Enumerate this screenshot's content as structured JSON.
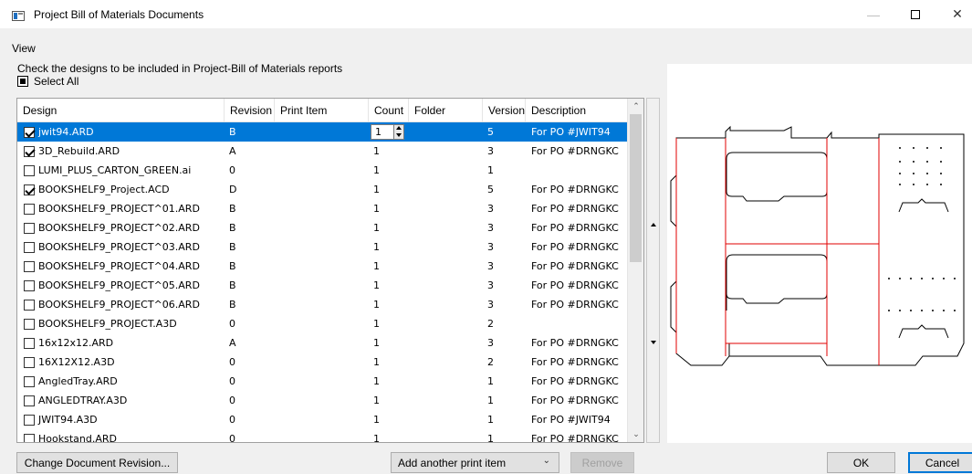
{
  "window": {
    "title": "Project Bill of Materials Documents"
  },
  "menu": {
    "view": "View"
  },
  "instructions": "Check the designs to be included in Project-Bill of Materials reports",
  "select_all": {
    "label": "Select All",
    "state": "indeterminate"
  },
  "columns": [
    "Design",
    "Revision",
    "Print Item",
    "Count",
    "Folder",
    "Version",
    "Description"
  ],
  "rows": [
    {
      "checked": true,
      "design": "jwit94.ARD",
      "revision": "B",
      "print_item": "",
      "count": "1",
      "folder": "",
      "version": "5",
      "description": "For PO #JWIT94",
      "selected": true
    },
    {
      "checked": true,
      "design": "3D_Rebuild.ARD",
      "revision": "A",
      "print_item": "",
      "count": "1",
      "folder": "",
      "version": "3",
      "description": "For PO #DRNGKC"
    },
    {
      "checked": false,
      "design": "LUMI_PLUS_CARTON_GREEN.ai",
      "revision": "0",
      "print_item": "",
      "count": "1",
      "folder": "",
      "version": "1",
      "description": ""
    },
    {
      "checked": true,
      "design": "BOOKSHELF9_Project.ACD",
      "revision": "D",
      "print_item": "",
      "count": "1",
      "folder": "",
      "version": "5",
      "description": "For PO #DRNGKC"
    },
    {
      "checked": false,
      "design": "BOOKSHELF9_PROJECT^01.ARD",
      "revision": "B",
      "print_item": "",
      "count": "1",
      "folder": "",
      "version": "3",
      "description": "For PO #DRNGKC"
    },
    {
      "checked": false,
      "design": "BOOKSHELF9_PROJECT^02.ARD",
      "revision": "B",
      "print_item": "",
      "count": "1",
      "folder": "",
      "version": "3",
      "description": "For PO #DRNGKC"
    },
    {
      "checked": false,
      "design": "BOOKSHELF9_PROJECT^03.ARD",
      "revision": "B",
      "print_item": "",
      "count": "1",
      "folder": "",
      "version": "3",
      "description": "For PO #DRNGKC"
    },
    {
      "checked": false,
      "design": "BOOKSHELF9_PROJECT^04.ARD",
      "revision": "B",
      "print_item": "",
      "count": "1",
      "folder": "",
      "version": "3",
      "description": "For PO #DRNGKC"
    },
    {
      "checked": false,
      "design": "BOOKSHELF9_PROJECT^05.ARD",
      "revision": "B",
      "print_item": "",
      "count": "1",
      "folder": "",
      "version": "3",
      "description": "For PO #DRNGKC"
    },
    {
      "checked": false,
      "design": "BOOKSHELF9_PROJECT^06.ARD",
      "revision": "B",
      "print_item": "",
      "count": "1",
      "folder": "",
      "version": "3",
      "description": "For PO #DRNGKC"
    },
    {
      "checked": false,
      "design": "BOOKSHELF9_PROJECT.A3D",
      "revision": "0",
      "print_item": "",
      "count": "1",
      "folder": "",
      "version": "2",
      "description": ""
    },
    {
      "checked": false,
      "design": "16x12x12.ARD",
      "revision": "A",
      "print_item": "",
      "count": "1",
      "folder": "",
      "version": "3",
      "description": "For PO #DRNGKC"
    },
    {
      "checked": false,
      "design": "16X12X12.A3D",
      "revision": "0",
      "print_item": "",
      "count": "1",
      "folder": "",
      "version": "2",
      "description": "For PO #DRNGKC"
    },
    {
      "checked": false,
      "design": "AngledTray.ARD",
      "revision": "0",
      "print_item": "",
      "count": "1",
      "folder": "",
      "version": "1",
      "description": "For PO #DRNGKC"
    },
    {
      "checked": false,
      "design": "ANGLEDTRAY.A3D",
      "revision": "0",
      "print_item": "",
      "count": "1",
      "folder": "",
      "version": "1",
      "description": "For PO #DRNGKC"
    },
    {
      "checked": false,
      "design": "JWIT94.A3D",
      "revision": "0",
      "print_item": "",
      "count": "1",
      "folder": "",
      "version": "1",
      "description": "For PO #JWIT94"
    },
    {
      "checked": false,
      "design": "Hookstand.ARD",
      "revision": "0",
      "print_item": "",
      "count": "1",
      "folder": "",
      "version": "1",
      "description": "For PO #DRNGKC"
    }
  ],
  "buttons": {
    "change_revision": "Change Document Revision...",
    "print_item_select": "Add another print item",
    "remove": "Remove",
    "ok": "OK",
    "cancel": "Cancel"
  },
  "icons": {
    "app": "document-list-icon",
    "minimize": "minimize-icon",
    "maximize": "maximize-icon",
    "close": "close-icon"
  },
  "colors": {
    "selection": "#0078d7",
    "dieline_cut": "#000000",
    "dieline_crease": "#e00000"
  }
}
